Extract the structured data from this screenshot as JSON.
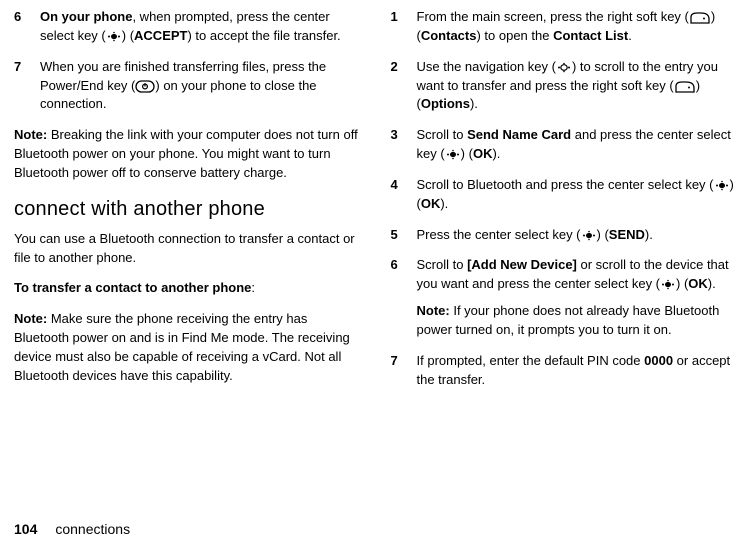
{
  "left": {
    "step6": {
      "num": "6",
      "a": "On your phone",
      "b": ", when prompted, press the center select key (",
      "c": ") (",
      "d": "ACCEPT",
      "e": ") to accept the file transfer."
    },
    "step7": {
      "num": "7",
      "a": "When you are finished transferring files, press the Power/End key (",
      "b": ") on your phone to close the connection."
    },
    "note1": {
      "lead": "Note:",
      "body": " Breaking the link with your computer does not turn off Bluetooth power on your phone. You might want to turn Bluetooth power off to conserve battery charge."
    },
    "heading": "connect with another phone",
    "intro": "You can use a Bluetooth connection to transfer a contact or file to another phone.",
    "subhead": {
      "a": "To transfer a contact to another phone",
      "b": ":"
    },
    "note2": {
      "lead": "Note:",
      "body": " Make sure the phone receiving the entry has Bluetooth power on and is in Find Me mode. The receiving device must also be capable of receiving a vCard. Not all Bluetooth devices have this capability."
    }
  },
  "right": {
    "step1": {
      "num": "1",
      "a": "From the main screen, press the right soft key (",
      "b": ") (",
      "c": "Contacts",
      "d": ") to open the ",
      "e": "Contact List",
      "f": "."
    },
    "step2": {
      "num": "2",
      "a": "Use the navigation key (",
      "b": ") to scroll to the entry you want to transfer and press the right soft key (",
      "c": ") (",
      "d": "Options",
      "e": ")."
    },
    "step3": {
      "num": "3",
      "a": "Scroll to ",
      "b": "Send Name Card",
      "c": " and press the center select key (",
      "d": ") (",
      "e": "OK",
      "f": ")."
    },
    "step4": {
      "num": "4",
      "a": "Scroll to Bluetooth and press the center select key (",
      "b": ") (",
      "c": "OK",
      "d": ")."
    },
    "step5": {
      "num": "5",
      "a": "Press the center select key (",
      "b": ") (",
      "c": "SEND",
      "d": ")."
    },
    "step6": {
      "num": "6",
      "a": "Scroll to ",
      "b": "[Add New Device]",
      "c": " or scroll to the device that you want and press the center select key (",
      "d": ") (",
      "e": "OK",
      "f": ")."
    },
    "note3": {
      "lead": "Note:",
      "body": " If your phone does not already have Bluetooth power turned on, it prompts you to turn it on."
    },
    "step7": {
      "num": "7",
      "a": "If prompted, enter the default PIN code ",
      "b": "0000",
      "c": " or accept the transfer."
    }
  },
  "footer": {
    "page": "104",
    "section": "connections"
  }
}
